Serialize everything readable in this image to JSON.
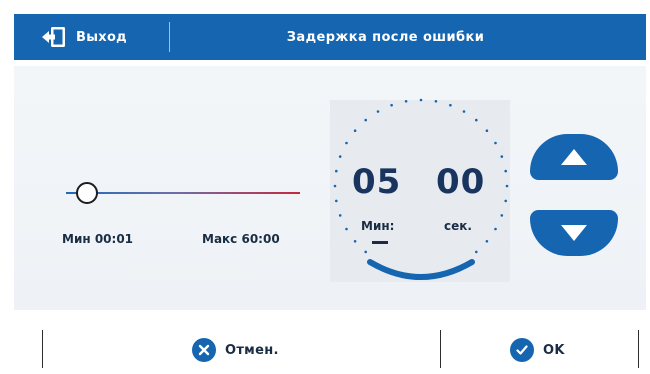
{
  "header": {
    "exit_label": "Выход",
    "title": "Задержка после ошибки",
    "exit_icon": "exit-door-icon"
  },
  "slider": {
    "min_label": "Мин 00:01",
    "max_label": "Макс 60:00",
    "level": 0.09
  },
  "timer": {
    "minutes": "05",
    "seconds": "00",
    "minutes_unit": "Мин:",
    "seconds_unit": "сек."
  },
  "controls": {
    "up_icon": "arrow-up-icon",
    "down_icon": "arrow-down-icon"
  },
  "footer": {
    "cancel_label": "Отмен.",
    "cancel_icon": "close-circle-icon",
    "ok_label": "OK",
    "ok_icon": "check-circle-icon"
  },
  "colors": {
    "accent": "#1565b0",
    "slider_start": "#1f6bb8",
    "slider_end": "#c8283a",
    "text_dark": "#1b2d43"
  }
}
